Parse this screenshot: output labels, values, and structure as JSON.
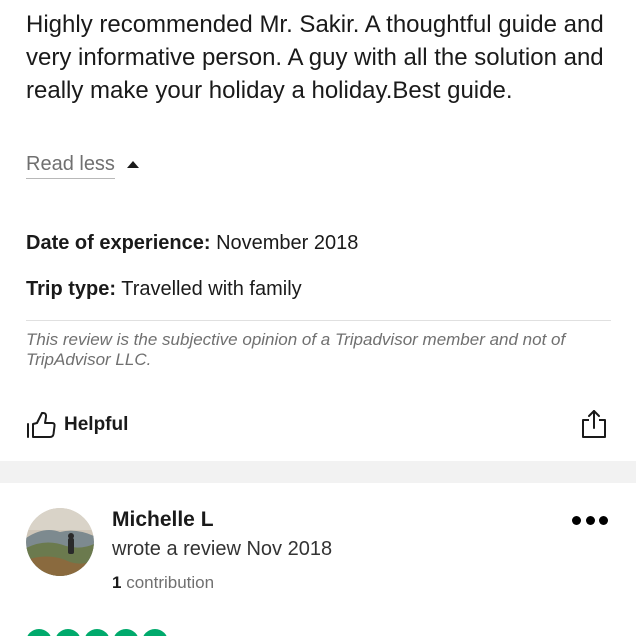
{
  "review": {
    "body": "Highly recommended Mr. Sakir. A thoughtful guide and very informative person. A guy with all the solution and really make your holiday a holiday.Best guide.",
    "read_less_label": "Read less",
    "date_label": "Date of experience:",
    "date_value": "November 2018",
    "trip_label": "Trip type:",
    "trip_value": "Travelled with family",
    "disclaimer": "This review is the subjective opinion of a Tripadvisor member and not of TripAdvisor LLC.",
    "helpful_label": "Helpful"
  },
  "next_review": {
    "reviewer_name": "Michelle L",
    "review_date": "wrote a review Nov 2018",
    "contribution_count": "1",
    "contribution_label": "contribution",
    "rating_bubbles": 5
  },
  "icons": {
    "read_less": "caret-up-icon",
    "helpful": "thumbs-up-icon",
    "share": "share-icon",
    "more": "more-icon"
  },
  "colors": {
    "text": "#1a1a1a",
    "muted": "#707070",
    "rating_green": "#00aa6c",
    "section_gap": "#f2f2f2"
  }
}
